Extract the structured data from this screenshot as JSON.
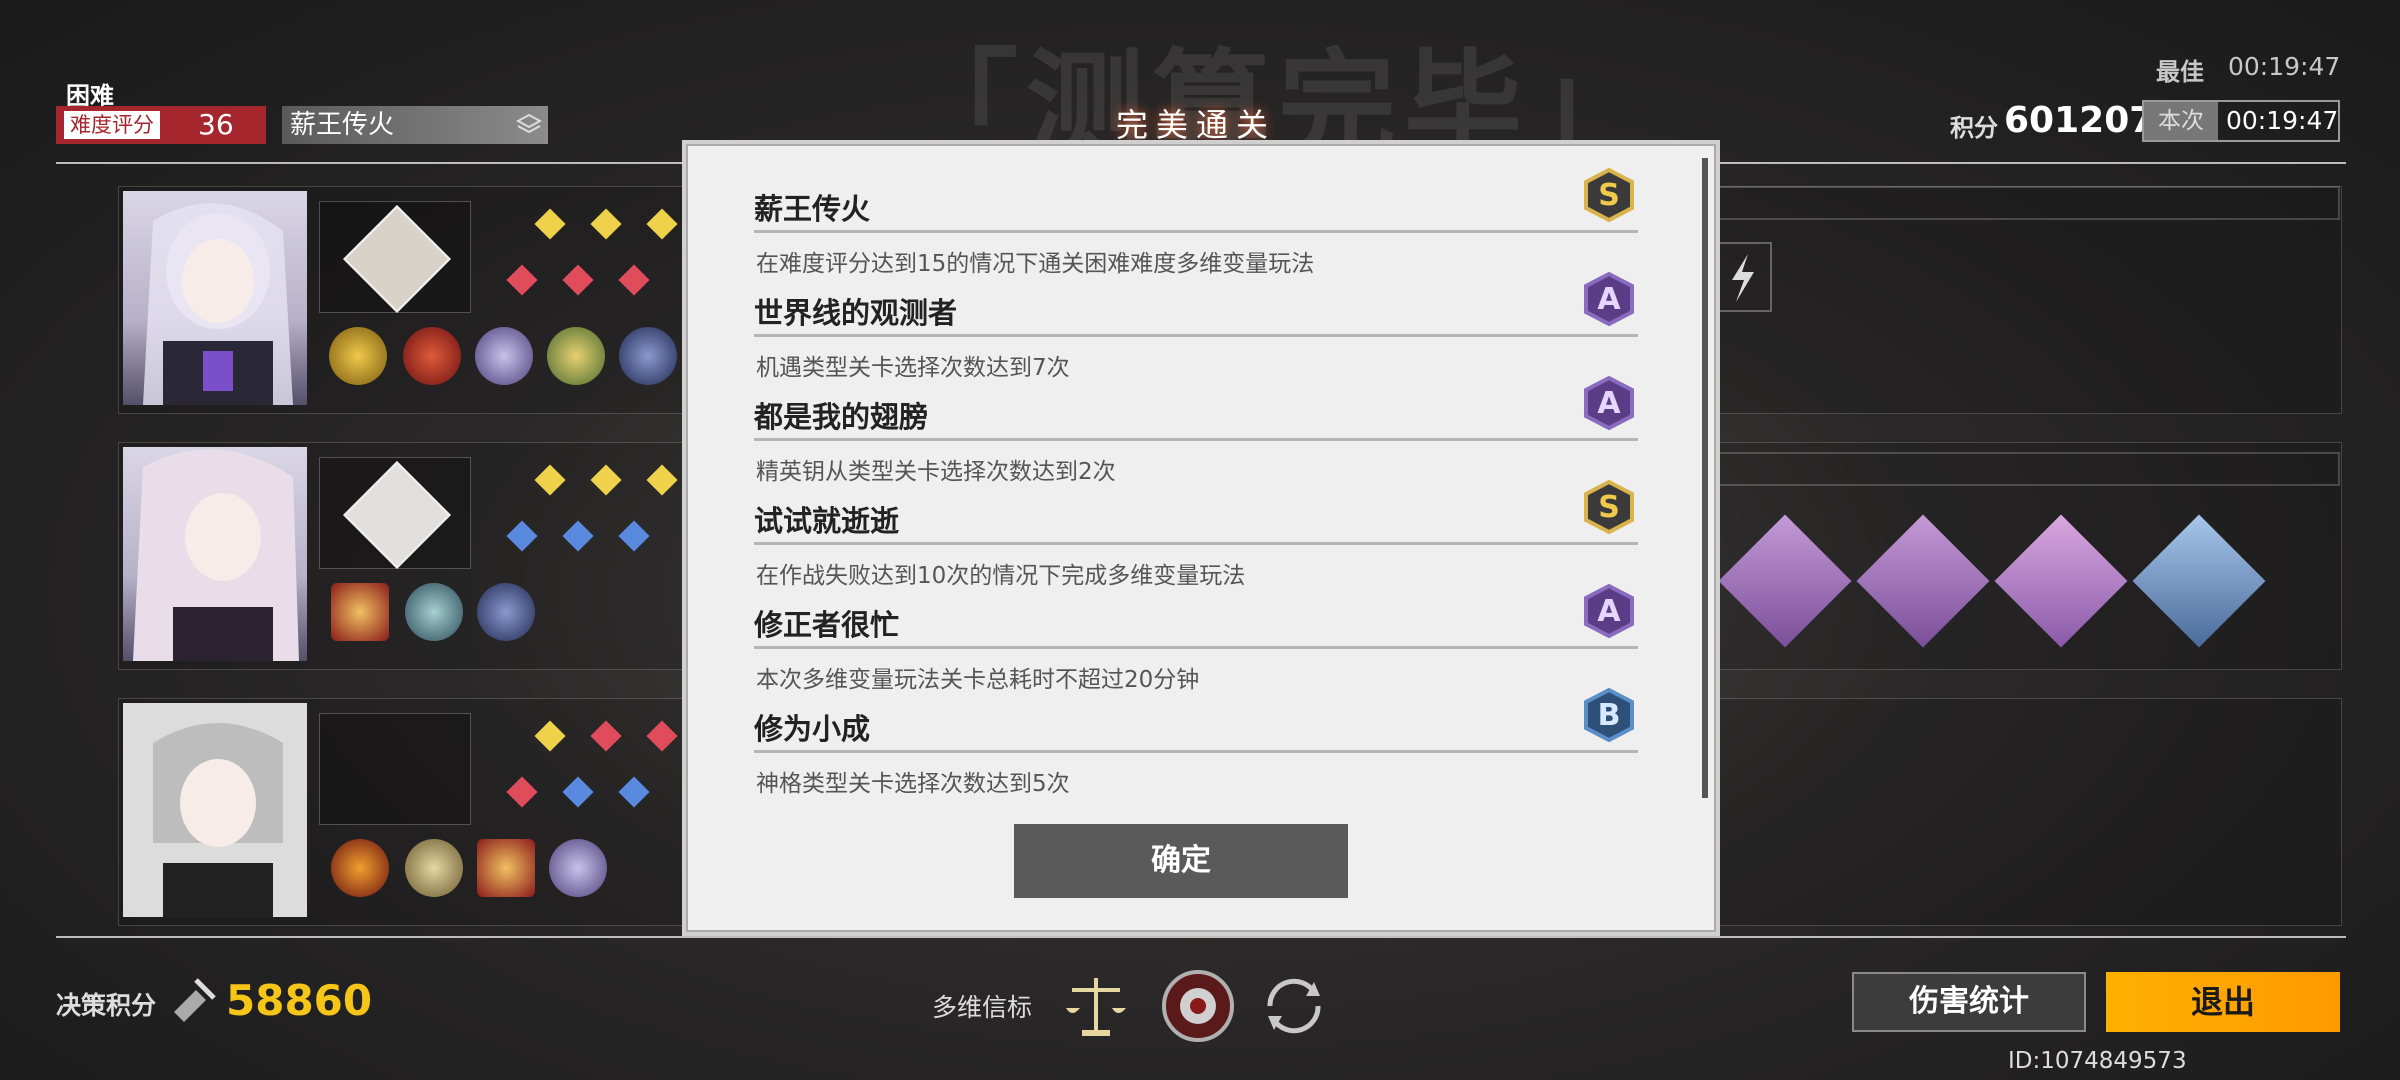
{
  "background_title": "「测算完毕」",
  "difficulty": {
    "label": "困难",
    "rating_label": "难度评分",
    "rating_value": "36",
    "mode": "薪王传火"
  },
  "best": {
    "label": "最佳",
    "time": "00:19:47"
  },
  "score": {
    "label": "积分",
    "value": "601207"
  },
  "current": {
    "label": "本次",
    "time": "00:19:47"
  },
  "modal": {
    "title": "完美通关",
    "achievements": [
      {
        "title": "薪王传火",
        "desc": "在难度评分达到15的情况下通关困难难度多维变量玩法",
        "grade": "S"
      },
      {
        "title": "世界线的观测者",
        "desc": "机遇类型关卡选择次数达到7次",
        "grade": "A"
      },
      {
        "title": "都是我的翅膀",
        "desc": "精英钥从类型关卡选择次数达到2次",
        "grade": "A"
      },
      {
        "title": "试试就逝逝",
        "desc": "在作战失败达到10次的情况下完成多维变量玩法",
        "grade": "S"
      },
      {
        "title": "修正者很忙",
        "desc": "本次多维变量玩法关卡总耗时不超过20分钟",
        "grade": "A"
      },
      {
        "title": "修为小成",
        "desc": "神格类型关卡选择次数达到5次",
        "grade": "B"
      }
    ],
    "confirm_label": "确定"
  },
  "decision": {
    "label": "决策积分",
    "value": "58860"
  },
  "beacon": {
    "label": "多维信标"
  },
  "buttons": {
    "damage_stats": "伤害统计",
    "exit": "退出"
  },
  "user_id": "ID:1074849573",
  "colors": {
    "accent_red": "#a6262e",
    "exit_orange": "#ff9a00",
    "score_yellow": "#f5c518",
    "grade_S": "#d9b44a",
    "grade_A": "#8a6bbf",
    "grade_B": "#5b8fc7"
  }
}
